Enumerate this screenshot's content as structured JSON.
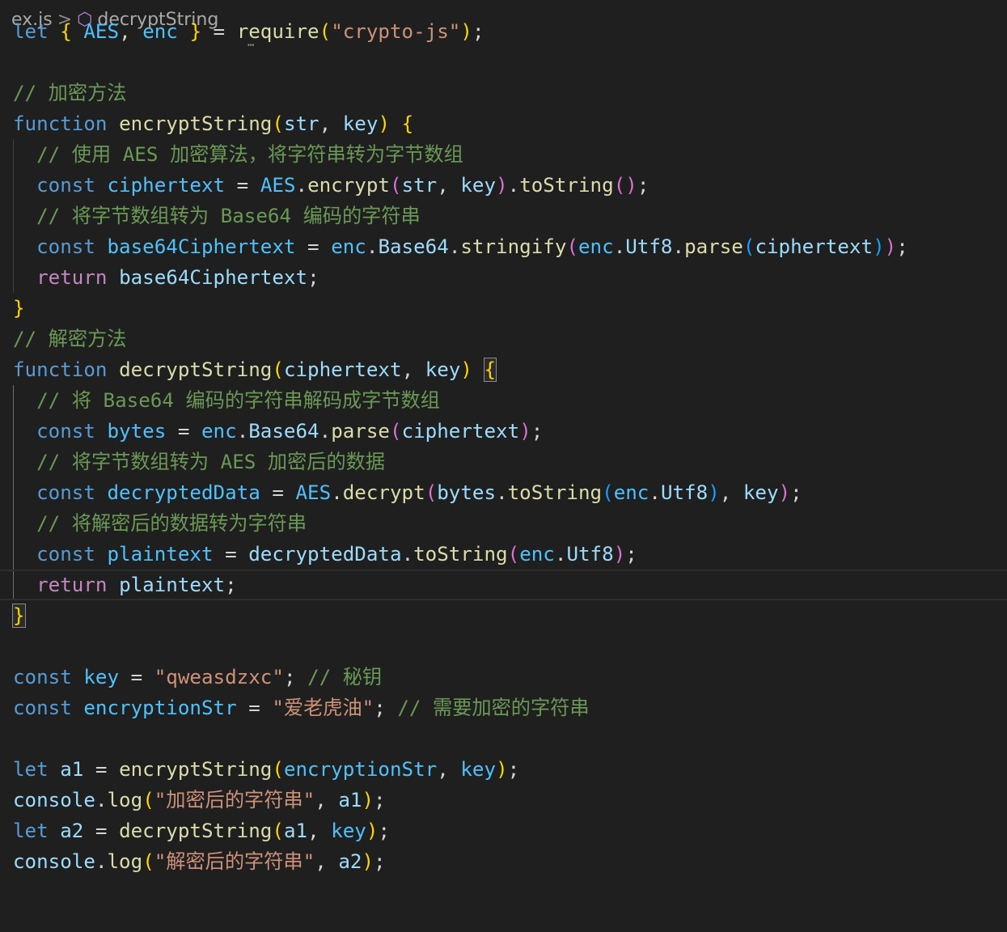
{
  "breadcrumb": {
    "file": "ex.js",
    "separator": ">",
    "symbol_icon": "cube-method-icon",
    "symbol": "decryptString"
  },
  "colors": {
    "background": "#1f1f1f",
    "keyword": "#569cd6",
    "control_keyword": "#c586c0",
    "function": "#dcdcaa",
    "variable": "#9cdcfe",
    "constant": "#4fc1ff",
    "string": "#ce9178",
    "comment": "#6a9955",
    "bracket_level1": "#ffd700",
    "bracket_level2": "#da70d6",
    "bracket_level3": "#179fff"
  },
  "editor": {
    "lines": [
      [
        [
          "let",
          "kw"
        ],
        [
          " ",
          ""
        ],
        [
          "{",
          "p1"
        ],
        [
          " ",
          ""
        ],
        [
          "AES",
          "cst"
        ],
        [
          ", ",
          ""
        ],
        [
          "enc",
          "cst"
        ],
        [
          " ",
          ""
        ],
        [
          "}",
          "p1"
        ],
        [
          " = ",
          ""
        ],
        [
          "require",
          "fn"
        ],
        [
          "(",
          "p1"
        ],
        [
          "\"crypto-js\"",
          "str"
        ],
        [
          ")",
          "p1"
        ],
        [
          ";",
          ""
        ]
      ],
      [],
      [
        [
          "// 加密方法",
          "cm"
        ]
      ],
      [
        [
          "function",
          "kw"
        ],
        [
          " ",
          ""
        ],
        [
          "encryptString",
          "fn"
        ],
        [
          "(",
          "p1"
        ],
        [
          "str",
          "var"
        ],
        [
          ", ",
          ""
        ],
        [
          "key",
          "var"
        ],
        [
          ")",
          "p1"
        ],
        [
          " ",
          ""
        ],
        [
          "{",
          "p1"
        ]
      ],
      [
        [
          "  ",
          ""
        ],
        [
          "// 使用 AES 加密算法，将字符串转为字节数组",
          "cm"
        ]
      ],
      [
        [
          "  ",
          ""
        ],
        [
          "const",
          "kw"
        ],
        [
          " ",
          ""
        ],
        [
          "ciphertext",
          "cst"
        ],
        [
          " = ",
          ""
        ],
        [
          "AES",
          "cst"
        ],
        [
          ".",
          ""
        ],
        [
          "encrypt",
          "fn"
        ],
        [
          "(",
          "p2"
        ],
        [
          "str",
          "var"
        ],
        [
          ", ",
          ""
        ],
        [
          "key",
          "var"
        ],
        [
          ")",
          "p2"
        ],
        [
          ".",
          ""
        ],
        [
          "toString",
          "fn"
        ],
        [
          "()",
          "p2"
        ],
        [
          ";",
          ""
        ]
      ],
      [
        [
          "  ",
          ""
        ],
        [
          "// 将字节数组转为 Base64 编码的字符串",
          "cm"
        ]
      ],
      [
        [
          "  ",
          ""
        ],
        [
          "const",
          "kw"
        ],
        [
          " ",
          ""
        ],
        [
          "base64Ciphertext",
          "cst"
        ],
        [
          " = ",
          ""
        ],
        [
          "enc",
          "cst"
        ],
        [
          ".",
          ""
        ],
        [
          "Base64",
          "var"
        ],
        [
          ".",
          ""
        ],
        [
          "stringify",
          "fn"
        ],
        [
          "(",
          "p2"
        ],
        [
          "enc",
          "cst"
        ],
        [
          ".",
          ""
        ],
        [
          "Utf8",
          "var"
        ],
        [
          ".",
          ""
        ],
        [
          "parse",
          "fn"
        ],
        [
          "(",
          "p3"
        ],
        [
          "ciphertext",
          "var"
        ],
        [
          ")",
          "p3"
        ],
        [
          ")",
          "p2"
        ],
        [
          ";",
          ""
        ]
      ],
      [
        [
          "  ",
          ""
        ],
        [
          "return",
          "kc"
        ],
        [
          " ",
          ""
        ],
        [
          "base64Ciphertext",
          "var"
        ],
        [
          ";",
          ""
        ]
      ],
      [
        [
          "}",
          "p1"
        ]
      ],
      [
        [
          "// 解密方法",
          "cm"
        ]
      ],
      [
        [
          "function",
          "kw"
        ],
        [
          " ",
          ""
        ],
        [
          "decryptString",
          "fn"
        ],
        [
          "(",
          "p1"
        ],
        [
          "ciphertext",
          "var"
        ],
        [
          ", ",
          ""
        ],
        [
          "key",
          "var"
        ],
        [
          ")",
          "p1"
        ],
        [
          " ",
          ""
        ],
        [
          "{",
          "p1 bm"
        ]
      ],
      [
        [
          "  ",
          ""
        ],
        [
          "// 将 Base64 编码的字符串解码成字节数组",
          "cm"
        ]
      ],
      [
        [
          "  ",
          ""
        ],
        [
          "const",
          "kw"
        ],
        [
          " ",
          ""
        ],
        [
          "bytes",
          "cst"
        ],
        [
          " = ",
          ""
        ],
        [
          "enc",
          "cst"
        ],
        [
          ".",
          ""
        ],
        [
          "Base64",
          "var"
        ],
        [
          ".",
          ""
        ],
        [
          "parse",
          "fn"
        ],
        [
          "(",
          "p2"
        ],
        [
          "ciphertext",
          "var"
        ],
        [
          ")",
          "p2"
        ],
        [
          ";",
          ""
        ]
      ],
      [
        [
          "  ",
          ""
        ],
        [
          "// 将字节数组转为 AES 加密后的数据",
          "cm"
        ]
      ],
      [
        [
          "  ",
          ""
        ],
        [
          "const",
          "kw"
        ],
        [
          " ",
          ""
        ],
        [
          "decryptedData",
          "cst"
        ],
        [
          " = ",
          ""
        ],
        [
          "AES",
          "cst"
        ],
        [
          ".",
          ""
        ],
        [
          "decrypt",
          "fn"
        ],
        [
          "(",
          "p2"
        ],
        [
          "bytes",
          "var"
        ],
        [
          ".",
          ""
        ],
        [
          "toString",
          "fn"
        ],
        [
          "(",
          "p3"
        ],
        [
          "enc",
          "cst"
        ],
        [
          ".",
          ""
        ],
        [
          "Utf8",
          "var"
        ],
        [
          ")",
          "p3"
        ],
        [
          ", ",
          ""
        ],
        [
          "key",
          "var"
        ],
        [
          ")",
          "p2"
        ],
        [
          ";",
          ""
        ]
      ],
      [
        [
          "  ",
          ""
        ],
        [
          "// 将解密后的数据转为字符串",
          "cm"
        ]
      ],
      [
        [
          "  ",
          ""
        ],
        [
          "const",
          "kw"
        ],
        [
          " ",
          ""
        ],
        [
          "plaintext",
          "cst"
        ],
        [
          " = ",
          ""
        ],
        [
          "decryptedData",
          "var"
        ],
        [
          ".",
          ""
        ],
        [
          "toString",
          "fn"
        ],
        [
          "(",
          "p2"
        ],
        [
          "enc",
          "cst"
        ],
        [
          ".",
          ""
        ],
        [
          "Utf8",
          "var"
        ],
        [
          ")",
          "p2"
        ],
        [
          ";",
          ""
        ]
      ],
      [
        [
          "  ",
          ""
        ],
        [
          "return",
          "kc"
        ],
        [
          " ",
          ""
        ],
        [
          "plaintext",
          "var"
        ],
        [
          ";",
          ""
        ]
      ],
      [
        [
          "}",
          "p1 bm"
        ]
      ],
      [],
      [
        [
          "const",
          "kw"
        ],
        [
          " ",
          ""
        ],
        [
          "key",
          "cst"
        ],
        [
          " = ",
          ""
        ],
        [
          "\"qweasdzxc\"",
          "str"
        ],
        [
          "; ",
          ""
        ],
        [
          "// 秘钥",
          "cm"
        ]
      ],
      [
        [
          "const",
          "kw"
        ],
        [
          " ",
          ""
        ],
        [
          "encryptionStr",
          "cst"
        ],
        [
          " = ",
          ""
        ],
        [
          "\"爱老虎油\"",
          "str"
        ],
        [
          "; ",
          ""
        ],
        [
          "// 需要加密的字符串",
          "cm"
        ]
      ],
      [],
      [
        [
          "let",
          "kw"
        ],
        [
          " ",
          ""
        ],
        [
          "a1",
          "var"
        ],
        [
          " = ",
          ""
        ],
        [
          "encryptString",
          "fn"
        ],
        [
          "(",
          "p1"
        ],
        [
          "encryptionStr",
          "cst"
        ],
        [
          ", ",
          ""
        ],
        [
          "key",
          "cst"
        ],
        [
          ")",
          "p1"
        ],
        [
          ";",
          ""
        ]
      ],
      [
        [
          "console",
          "var"
        ],
        [
          ".",
          ""
        ],
        [
          "log",
          "fn"
        ],
        [
          "(",
          "p1"
        ],
        [
          "\"加密后的字符串\"",
          "str"
        ],
        [
          ", ",
          ""
        ],
        [
          "a1",
          "var"
        ],
        [
          ")",
          "p1"
        ],
        [
          ";",
          ""
        ]
      ],
      [
        [
          "let",
          "kw"
        ],
        [
          " ",
          ""
        ],
        [
          "a2",
          "var"
        ],
        [
          " = ",
          ""
        ],
        [
          "decryptString",
          "fn"
        ],
        [
          "(",
          "p1"
        ],
        [
          "a1",
          "var"
        ],
        [
          ", ",
          ""
        ],
        [
          "key",
          "cst"
        ],
        [
          ")",
          "p1"
        ],
        [
          ";",
          ""
        ]
      ],
      [
        [
          "console",
          "var"
        ],
        [
          ".",
          ""
        ],
        [
          "log",
          "fn"
        ],
        [
          "(",
          "p1"
        ],
        [
          "\"解密后的字符串\"",
          "str"
        ],
        [
          ", ",
          ""
        ],
        [
          "a2",
          "var"
        ],
        [
          ")",
          "p1"
        ],
        [
          ";",
          ""
        ]
      ]
    ]
  }
}
